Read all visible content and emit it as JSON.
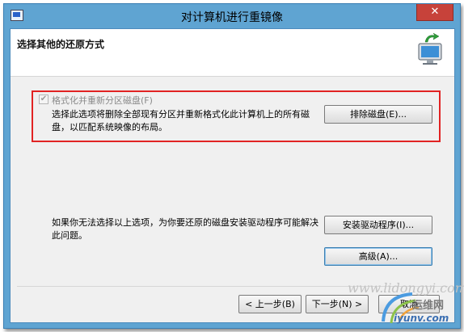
{
  "window": {
    "title": "对计算机进行重镜像",
    "close_glyph": "✕"
  },
  "header": {
    "page_title": "选择其他的还原方式"
  },
  "format_option": {
    "checkbox_label": "格式化并重新分区磁盘(F)",
    "checked": true,
    "check_glyph": "✔",
    "description": "选择此选项将删除全部现有分区并重新格式化此计算机上的所有磁盘，以匹配系统映像的布局。",
    "exclude_button": "排除磁盘(E)..."
  },
  "driver": {
    "text": "如果你无法选择以上选项，为你要还原的磁盘安装驱动程序可能解决此问题。",
    "install_button": "安装驱动程序(I)...",
    "advanced_button": "高级(A)..."
  },
  "nav": {
    "back_button": "< 上一步(B)",
    "next_button": "下一步(N) >",
    "cancel_button": "取消"
  },
  "watermark": {
    "url_text": "www.lidongyi.com",
    "site_text": "运维网",
    "domain_text": "iyunv.com"
  }
}
